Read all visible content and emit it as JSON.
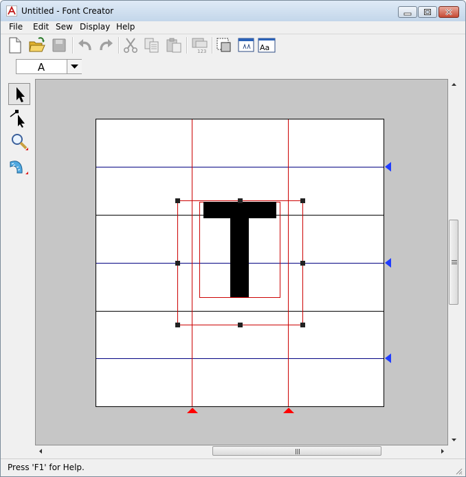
{
  "window": {
    "title": "Untitled - Font Creator",
    "app_icon": "font-creator-app-icon",
    "controls": [
      "minimize-icon",
      "maximize-icon",
      "close-icon"
    ]
  },
  "menu": {
    "items": [
      "File",
      "Edit",
      "Sew",
      "Display",
      "Help"
    ]
  },
  "toolbar": {
    "buttons": [
      {
        "name": "new-file-icon"
      },
      {
        "name": "open-folder-icon"
      },
      {
        "name": "save-icon",
        "enabled": false
      },
      {
        "name": "undo-icon",
        "enabled": false
      },
      {
        "name": "redo-icon",
        "enabled": false
      },
      {
        "name": "cut-icon",
        "enabled": false
      },
      {
        "name": "copy-icon",
        "enabled": false
      },
      {
        "name": "paste-icon",
        "enabled": false
      },
      {
        "name": "numbering-icon",
        "enabled": false,
        "label": "123"
      },
      {
        "name": "select-frame-icon"
      },
      {
        "name": "window-preview-icon"
      },
      {
        "name": "font-preview-icon",
        "label": "Aa"
      }
    ]
  },
  "character_selector": {
    "value": "A",
    "dropdown_icon": "chevron-down-icon"
  },
  "tools": [
    {
      "name": "arrow-pointer-icon",
      "active": true
    },
    {
      "name": "node-edit-icon",
      "active": false
    },
    {
      "name": "zoom-magnifier-icon",
      "active": false
    },
    {
      "name": "bend-tool-icon",
      "active": false
    }
  ],
  "canvas": {
    "background_color": "#c6c6c6",
    "guide_colors": {
      "baseline_black": "#000000",
      "blue_guides": "#000080",
      "red_guides": "#cc0000",
      "marker_blue": "#1f3cff",
      "marker_red": "#ff0000"
    },
    "glyph_color": "#000000"
  },
  "scrollbars": {
    "vertical": [
      "up-arrow-icon",
      "down-arrow-icon"
    ],
    "horizontal": [
      "left-arrow-icon",
      "right-arrow-icon"
    ]
  },
  "status": {
    "text": "Press 'F1' for Help."
  }
}
